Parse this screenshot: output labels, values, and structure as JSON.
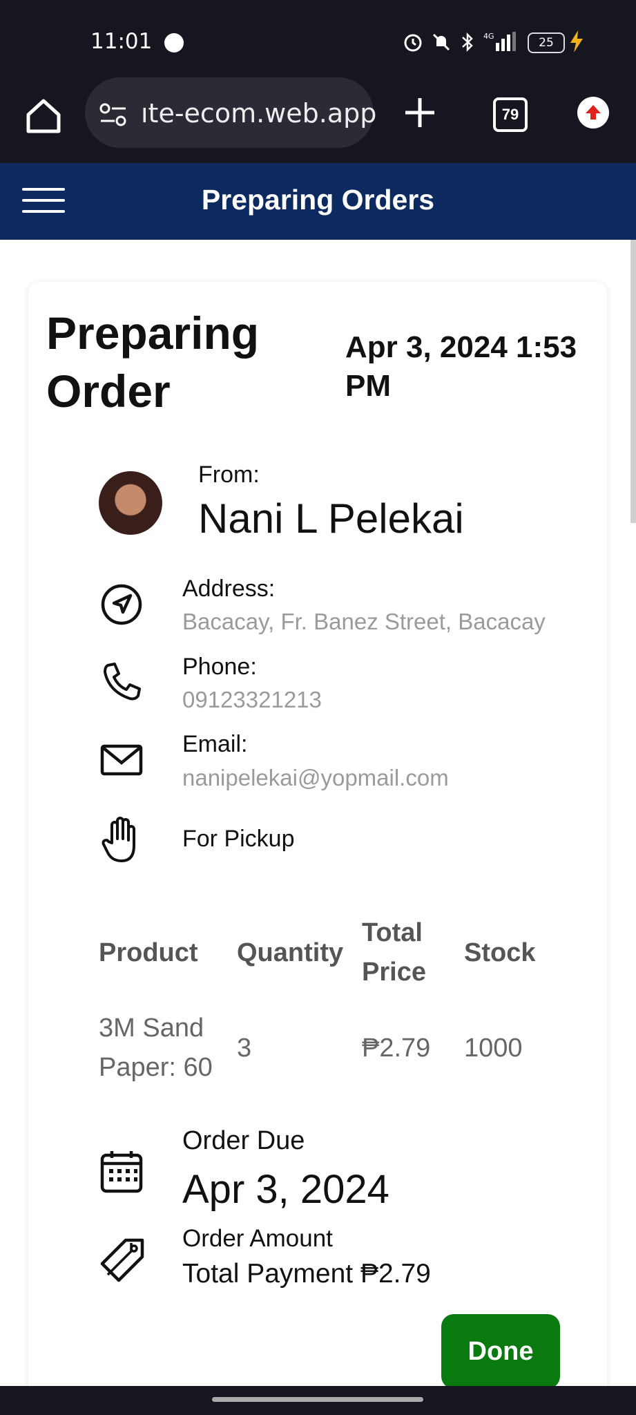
{
  "status_bar": {
    "time": "11:01",
    "battery": "25"
  },
  "browser": {
    "url": "ıte-ecom.web.app",
    "tab_count": "79"
  },
  "app_header": {
    "title": "Preparing Orders"
  },
  "order": {
    "title": "Preparing Order",
    "datetime": "Apr 3, 2024 1:53 PM",
    "from_label": "From:",
    "customer_name": "Nani L Pelekai",
    "address_label": "Address:",
    "address": "Bacacay, Fr. Banez Street, Bacacay",
    "phone_label": "Phone:",
    "phone": "09123321213",
    "email_label": "Email:",
    "email": "nanipelekai@yopmail.com",
    "delivery_method": "For Pickup",
    "table": {
      "headers": [
        "Product",
        "Quantity",
        "Total Price",
        "Stock"
      ],
      "rows": [
        {
          "product": "3M Sand Paper: 60",
          "quantity": "3",
          "total_price": "₱2.79",
          "stock": "1000"
        }
      ]
    },
    "due_label": "Order Due",
    "due_date": "Apr 3, 2024",
    "amount_label": "Order Amount",
    "amount_value": "Total Payment ₱2.79",
    "done_label": "Done"
  },
  "colors": {
    "header_bg": "#0c2a60",
    "done_button": "#087a10",
    "system_bg": "#15161f"
  }
}
